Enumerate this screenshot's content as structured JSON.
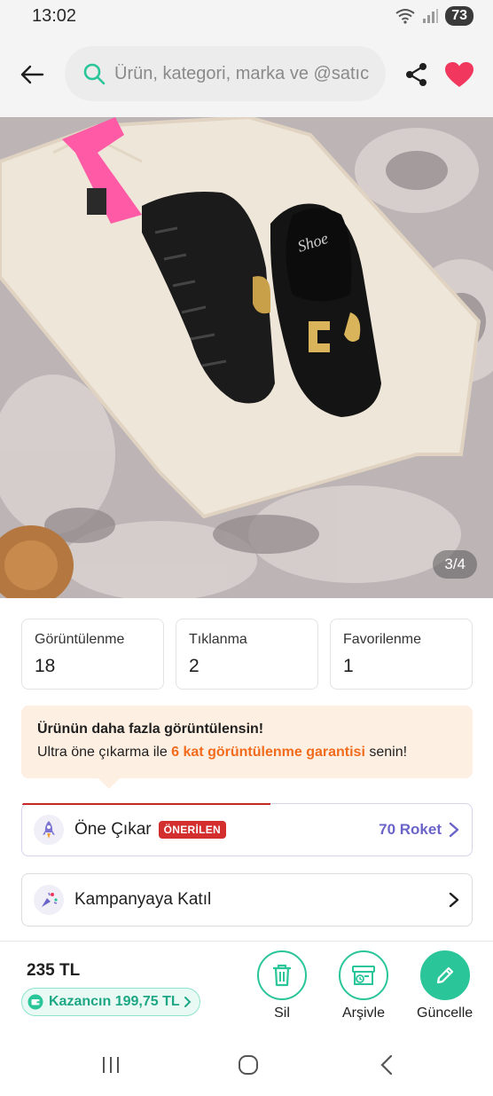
{
  "status_bar": {
    "time": "13:02",
    "battery": "73"
  },
  "search": {
    "placeholder": "Ürün, kategori, marka ve @satıc"
  },
  "gallery": {
    "counter": "3/4",
    "shoe_brand_text": "Shoe"
  },
  "stats": [
    {
      "label": "Görüntülenme",
      "value": "18"
    },
    {
      "label": "Tıklanma",
      "value": "2"
    },
    {
      "label": "Favorilenme",
      "value": "1"
    }
  ],
  "promo": {
    "title": "Ürünün daha fazla görüntülensin!",
    "text_before": "Ultra öne çıkarma ile ",
    "highlight": "6 kat görüntülenme garantisi",
    "text_after": " senin!"
  },
  "featured": {
    "label": "Öne Çıkar",
    "badge": "ÖNERİLEN",
    "price": "70 Roket"
  },
  "campaign": {
    "label": "Kampanyaya Katıl"
  },
  "bottom": {
    "price": "235 TL",
    "earnings": "Kazancın 199,75 TL",
    "actions": {
      "delete": "Sil",
      "archive": "Arşivle",
      "update": "Güncelle"
    }
  },
  "colors": {
    "accent": "#2bc59a",
    "heart": "#f2375e",
    "badge": "#d32f2f",
    "roket": "#6b64c8",
    "highlight": "#f26b1d"
  }
}
